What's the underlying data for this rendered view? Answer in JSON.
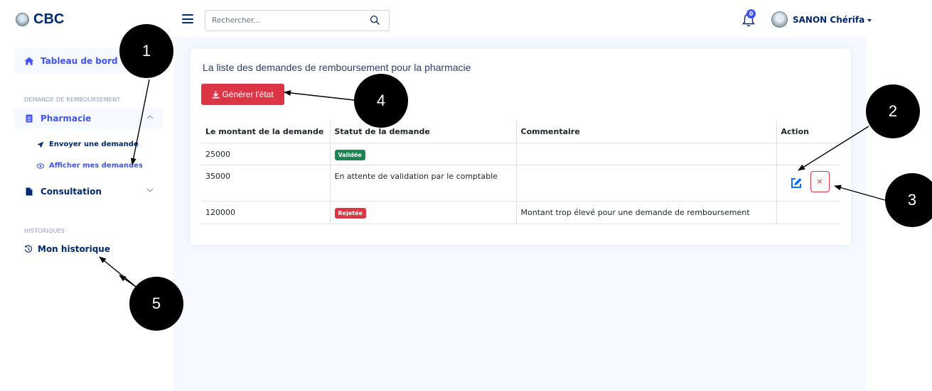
{
  "header": {
    "logo_text": "CBC",
    "search_placeholder": "Rechercher...",
    "notification_count": "0",
    "user_name": "SANON Chérifa"
  },
  "sidebar": {
    "dashboard": "Tableau de bord",
    "section_refund": "DEMANDE DE REMBOURSEMENT",
    "pharmacie": "Pharmacie",
    "send_request": "Envoyer une demande",
    "show_requests": "Afficher mes demandes",
    "consultation": "Consultation",
    "section_history": "HISTORIQUES",
    "my_history": "Mon historique"
  },
  "main": {
    "title": "La liste des demandes de remboursement pour la pharmacie",
    "generate_button": "Générer l'état",
    "table": {
      "headers": [
        "Le montant de la demande",
        "Statut de la demande",
        "Commentaire",
        "Action"
      ],
      "rows": [
        {
          "amount": "25000",
          "status": "Validée",
          "comment": ""
        },
        {
          "amount": "35000",
          "status": "En attente de validation par le comptable",
          "comment": ""
        },
        {
          "amount": "120000",
          "status": "Rejetée",
          "comment": "Montant trop élevé pour une demande de remboursement"
        }
      ]
    },
    "delete_glyph": "×"
  },
  "annotations": [
    "1",
    "2",
    "3",
    "4",
    "5"
  ],
  "colors": {
    "primary": "#4154f1",
    "navy": "#012970",
    "danger": "#dc3545",
    "success": "#198754",
    "background": "#f6f9ff"
  },
  "icons": [
    "menu-icon",
    "search-icon",
    "bell-icon",
    "house-icon",
    "file-icon",
    "send-icon",
    "eye-icon",
    "history-icon",
    "download-icon",
    "edit-icon",
    "close-icon",
    "chevron-up-icon",
    "chevron-down-icon"
  ]
}
